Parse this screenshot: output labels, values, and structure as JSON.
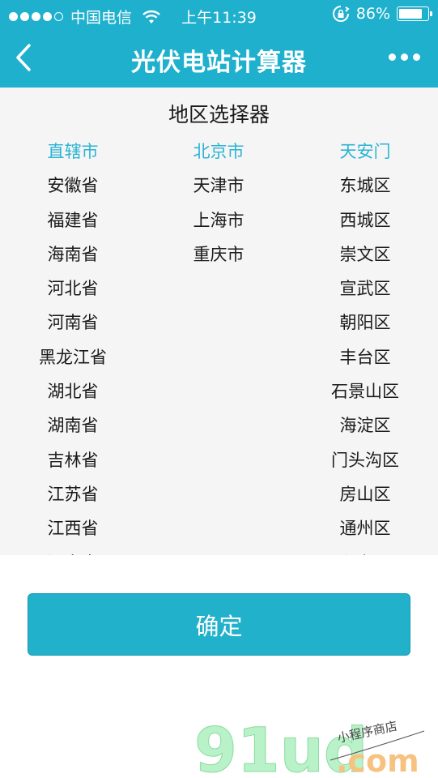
{
  "status_bar": {
    "carrier": "中国电信",
    "time": "上午11:39",
    "battery_percent": "86%",
    "battery_level": 0.86
  },
  "navbar": {
    "title": "光伏电站计算器"
  },
  "picker": {
    "title": "地区选择器",
    "provinces": [
      "直辖市",
      "安徽省",
      "福建省",
      "海南省",
      "河北省",
      "河南省",
      "黑龙江省",
      "湖北省",
      "湖南省",
      "吉林省",
      "江苏省",
      "江西省",
      "辽宁省"
    ],
    "cities": [
      "北京市",
      "天津市",
      "上海市",
      "重庆市"
    ],
    "districts": [
      "天安门",
      "东城区",
      "西城区",
      "崇文区",
      "宣武区",
      "朝阳区",
      "丰台区",
      "石景山区",
      "海淀区",
      "门头沟区",
      "房山区",
      "通州区",
      "顺义区"
    ],
    "selected_index": 0
  },
  "confirm_button": {
    "label": "确定"
  },
  "watermark": {
    "logo_text": "91ud",
    "domain": ".com",
    "tagline": "小程序商店"
  },
  "colors": {
    "header": "#1fb0cd",
    "selected": "#2cb4d4",
    "button": "#22b1cb"
  }
}
